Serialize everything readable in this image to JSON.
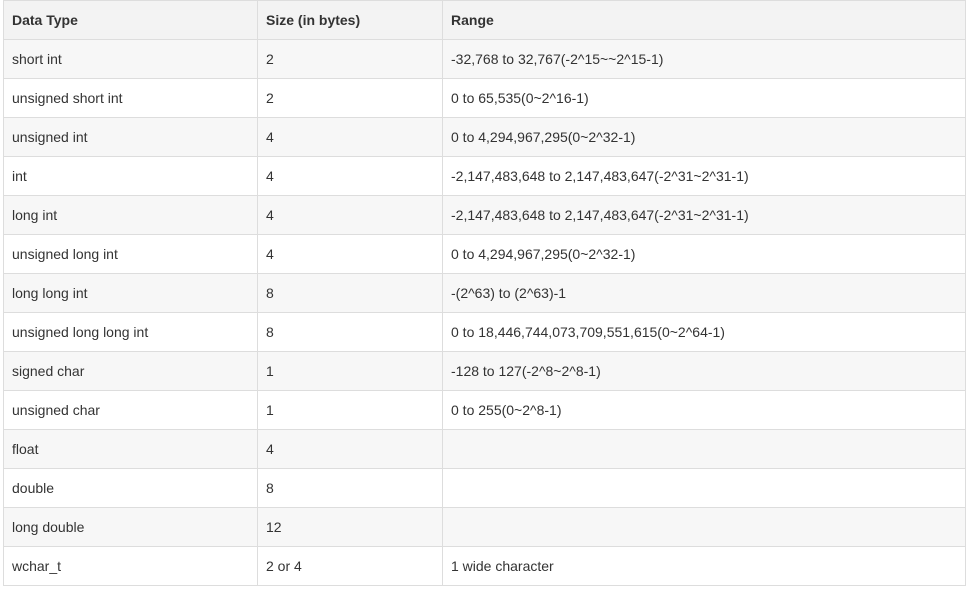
{
  "table": {
    "headers": [
      "Data Type",
      "Size (in bytes)",
      "Range"
    ],
    "rows": [
      [
        "short int",
        "2",
        "-32,768 to 32,767(-2^15~~2^15-1)"
      ],
      [
        "unsigned short int",
        "2",
        "0 to 65,535(0~2^16-1)"
      ],
      [
        "unsigned int",
        "4",
        "0 to 4,294,967,295(0~2^32-1)"
      ],
      [
        "int",
        "4",
        "-2,147,483,648 to 2,147,483,647(-2^31~2^31-1)"
      ],
      [
        "long int",
        "4",
        "-2,147,483,648 to 2,147,483,647(-2^31~2^31-1)"
      ],
      [
        "unsigned long int",
        "4",
        "0 to 4,294,967,295(0~2^32-1)"
      ],
      [
        "long long int",
        "8",
        "-(2^63) to (2^63)-1"
      ],
      [
        "unsigned long long int",
        "8",
        "0 to 18,446,744,073,709,551,615(0~2^64-1)"
      ],
      [
        "signed char",
        "1",
        "-128 to 127(-2^8~2^8-1)"
      ],
      [
        "unsigned char",
        "1",
        "0 to 255(0~2^8-1)"
      ],
      [
        "float",
        "4",
        ""
      ],
      [
        "double",
        "8",
        ""
      ],
      [
        "long double",
        "12",
        ""
      ],
      [
        "wchar_t",
        "2 or 4",
        "1 wide character"
      ]
    ]
  }
}
